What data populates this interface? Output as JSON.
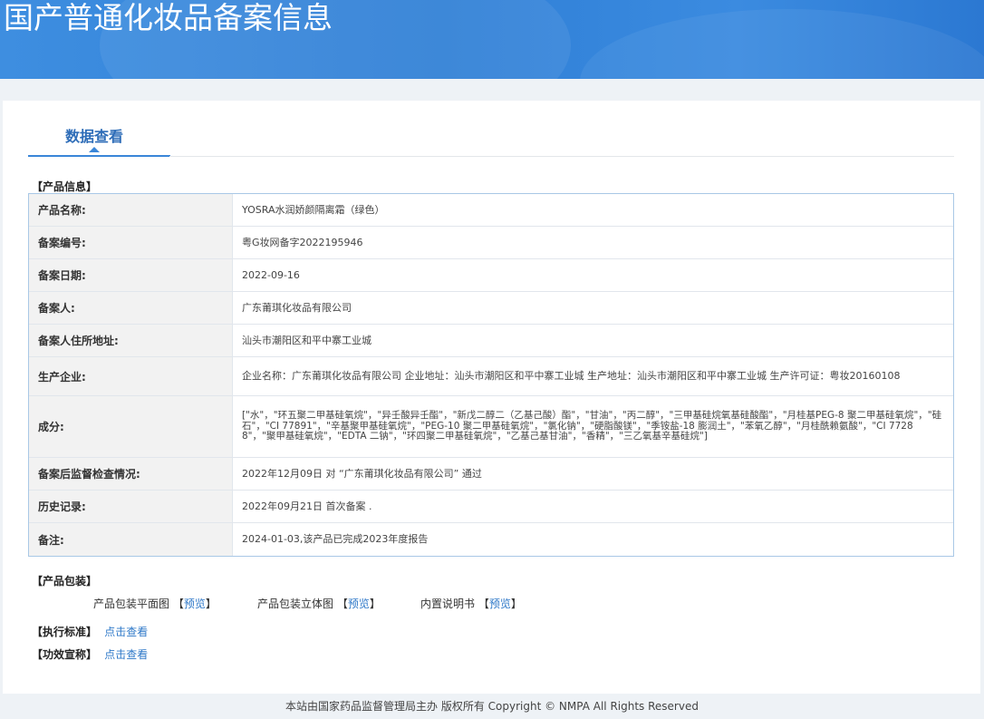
{
  "header": {
    "title": "国产普通化妆品备案信息"
  },
  "tabs": {
    "active": "数据查看"
  },
  "product_info": {
    "section_title": "【产品信息】",
    "rows": [
      {
        "label": "产品名称:",
        "value": "YOSRA水润娇颜隔离霜（绿色）"
      },
      {
        "label": "备案编号:",
        "value": "粤G妆网备字2022195946"
      },
      {
        "label": "备案日期:",
        "value": "2022-09-16"
      },
      {
        "label": "备案人:",
        "value": "广东莆琪化妆品有限公司"
      },
      {
        "label": "备案人住所地址:",
        "value": "汕头市潮阳区和平中寨工业城"
      },
      {
        "label": "生产企业:",
        "value": "企业名称：广东莆琪化妆品有限公司 企业地址：汕头市潮阳区和平中寨工业城 生产地址：汕头市潮阳区和平中寨工业城 生产许可证：粤妆20160108"
      },
      {
        "label": "成分:",
        "value": "[\"水\"，\"环五聚二甲基硅氧烷\"，\"异壬酸异壬酯\"，\"新戊二醇二（乙基己酸）酯\"，\"甘油\"，\"丙二醇\"，\"三甲基硅烷氧基硅酸酯\"，\"月桂基PEG-8 聚二甲基硅氧烷\"，\"硅石\"，\"CI 77891\"，\"辛基聚甲基硅氧烷\"，\"PEG-10 聚二甲基硅氧烷\"，\"氯化钠\"，\"硬脂酸镁\"，\"季铵盐-18 膨润土\"，\"苯氧乙醇\"，\"月桂酰赖氨酸\"，\"CI 77288\"，\"聚甲基硅氧烷\"，\"EDTA 二钠\"，\"环四聚二甲基硅氧烷\"，\"乙基己基甘油\"，\"香精\"，\"三乙氧基辛基硅烷\"]"
      },
      {
        "label": "备案后监督检查情况:",
        "value": "2022年12月09日 对 “广东莆琪化妆品有限公司” 通过"
      },
      {
        "label": "历史记录:",
        "value": "2022年09月21日 首次备案 ."
      },
      {
        "label": "备注:",
        "value": "2024-01-03,该产品已完成2023年度报告"
      }
    ]
  },
  "packaging": {
    "section_title": "【产品包装】",
    "items": [
      {
        "label": "产品包装平面图",
        "link": "预览"
      },
      {
        "label": "产品包装立体图",
        "link": "预览"
      },
      {
        "label": "内置说明书",
        "link": "预览"
      }
    ]
  },
  "standard": {
    "label": "【执行标准】",
    "link": "点击查看"
  },
  "efficacy": {
    "label": "【功效宣称】",
    "link": "点击查看"
  },
  "footer": {
    "text": "本站由国家药品监督管理局主办 版权所有 Copyright © NMPA All Rights Reserved"
  }
}
